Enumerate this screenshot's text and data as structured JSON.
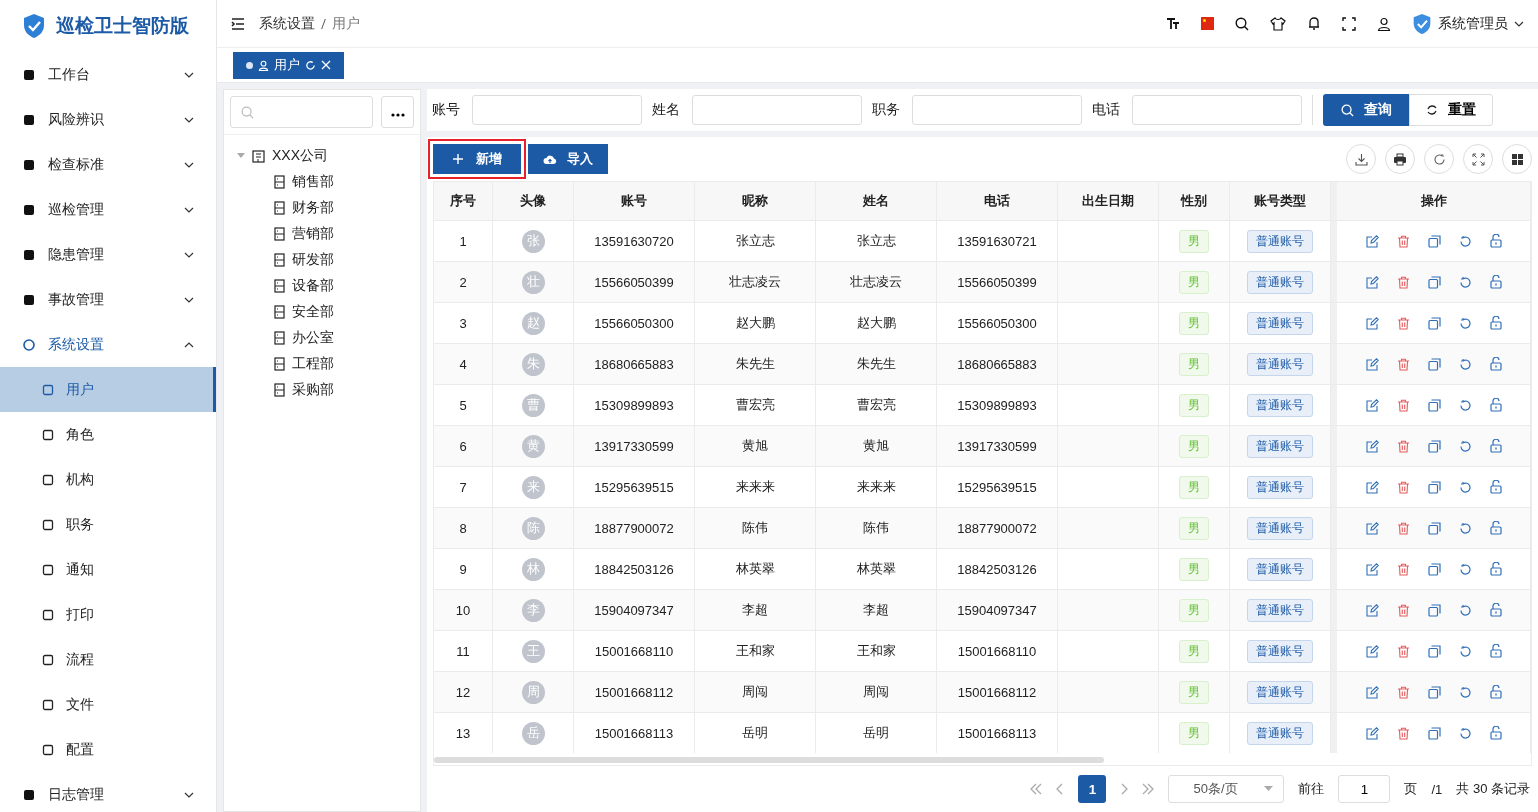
{
  "app": {
    "title": "巡检卫士智防版"
  },
  "sidebar": {
    "items": [
      {
        "label": "工作台",
        "expanded": false
      },
      {
        "label": "风险辨识",
        "expanded": false
      },
      {
        "label": "检查标准",
        "expanded": false
      },
      {
        "label": "巡检管理",
        "expanded": false
      },
      {
        "label": "隐患管理",
        "expanded": false
      },
      {
        "label": "事故管理",
        "expanded": false
      },
      {
        "label": "系统设置",
        "expanded": true,
        "children": [
          {
            "label": "用户",
            "selected": true
          },
          {
            "label": "角色",
            "selected": false
          },
          {
            "label": "机构",
            "selected": false
          },
          {
            "label": "职务",
            "selected": false
          },
          {
            "label": "通知",
            "selected": false
          },
          {
            "label": "打印",
            "selected": false
          },
          {
            "label": "流程",
            "selected": false
          },
          {
            "label": "文件",
            "selected": false
          },
          {
            "label": "配置",
            "selected": false
          }
        ]
      },
      {
        "label": "日志管理",
        "expanded": false
      }
    ]
  },
  "breadcrumb": [
    "系统设置",
    "用户"
  ],
  "header": {
    "user": "系统管理员"
  },
  "tabs": [
    {
      "label": "用户",
      "selected": true
    }
  ],
  "tree": {
    "root": {
      "label": "XXX公司",
      "expanded": true,
      "children": [
        {
          "label": "销售部"
        },
        {
          "label": "财务部"
        },
        {
          "label": "营销部"
        },
        {
          "label": "研发部"
        },
        {
          "label": "设备部"
        },
        {
          "label": "安全部"
        },
        {
          "label": "办公室"
        },
        {
          "label": "工程部"
        },
        {
          "label": "采购部"
        }
      ]
    }
  },
  "filters": [
    {
      "label": "账号"
    },
    {
      "label": "姓名"
    },
    {
      "label": "职务"
    },
    {
      "label": "电话"
    }
  ],
  "query_button": "查询",
  "reset_button": "重置",
  "toolbar": {
    "add_button": "新增",
    "add_highlighted": true,
    "import_button": "导入"
  },
  "table": {
    "columns": [
      "序号",
      "头像",
      "账号",
      "昵称",
      "姓名",
      "电话",
      "出生日期",
      "性别",
      "账号类型",
      "操作"
    ],
    "rows": [
      {
        "index": "1",
        "avatar": "张",
        "account": "13591630720",
        "nickname": "张立志",
        "name": "张立志",
        "phone": "13591630721",
        "gender": "男",
        "type": "普通账号"
      },
      {
        "index": "2",
        "avatar": "壮",
        "account": "15566050399",
        "nickname": "壮志凌云",
        "name": "壮志凌云",
        "phone": "15566050399",
        "gender": "男",
        "type": "普通账号"
      },
      {
        "index": "3",
        "avatar": "赵",
        "account": "15566050300",
        "nickname": "赵大鹏",
        "name": "赵大鹏",
        "phone": "15566050300",
        "gender": "男",
        "type": "普通账号"
      },
      {
        "index": "4",
        "avatar": "朱",
        "account": "18680665883",
        "nickname": "朱先生",
        "name": "朱先生",
        "phone": "18680665883",
        "gender": "男",
        "type": "普通账号"
      },
      {
        "index": "5",
        "avatar": "曹",
        "account": "15309899893",
        "nickname": "曹宏亮",
        "name": "曹宏亮",
        "phone": "15309899893",
        "gender": "男",
        "type": "普通账号"
      },
      {
        "index": "6",
        "avatar": "黄",
        "account": "13917330599",
        "nickname": "黄旭",
        "name": "黄旭",
        "phone": "13917330599",
        "gender": "男",
        "type": "普通账号"
      },
      {
        "index": "7",
        "avatar": "来",
        "account": "15295639515",
        "nickname": "来来来",
        "name": "来来来",
        "phone": "15295639515",
        "gender": "男",
        "type": "普通账号"
      },
      {
        "index": "8",
        "avatar": "陈",
        "account": "18877900072",
        "nickname": "陈伟",
        "name": "陈伟",
        "phone": "18877900072",
        "gender": "男",
        "type": "普通账号"
      },
      {
        "index": "9",
        "avatar": "林",
        "account": "18842503126",
        "nickname": "林英翠",
        "name": "林英翠",
        "phone": "18842503126",
        "gender": "男",
        "type": "普通账号"
      },
      {
        "index": "10",
        "avatar": "李",
        "account": "15904097347",
        "nickname": "李超",
        "name": "李超",
        "phone": "15904097347",
        "gender": "男",
        "type": "普通账号"
      },
      {
        "index": "11",
        "avatar": "王",
        "account": "15001668110",
        "nickname": "王和家",
        "name": "王和家",
        "phone": "15001668110",
        "gender": "男",
        "type": "普通账号"
      },
      {
        "index": "12",
        "avatar": "周",
        "account": "15001668112",
        "nickname": "周闯",
        "name": "周闯",
        "phone": "15001668112",
        "gender": "男",
        "type": "普通账号"
      },
      {
        "index": "13",
        "avatar": "岳",
        "account": "15001668113",
        "nickname": "岳明",
        "name": "岳明",
        "phone": "15001668113",
        "gender": "男",
        "type": "普通账号"
      }
    ]
  },
  "pagination": {
    "current": "1",
    "page_size": "50条/页",
    "goto_label": "前往",
    "goto_value": "1",
    "page_unit": "页",
    "total_pages": "/1",
    "total": "共 30 条记录"
  }
}
